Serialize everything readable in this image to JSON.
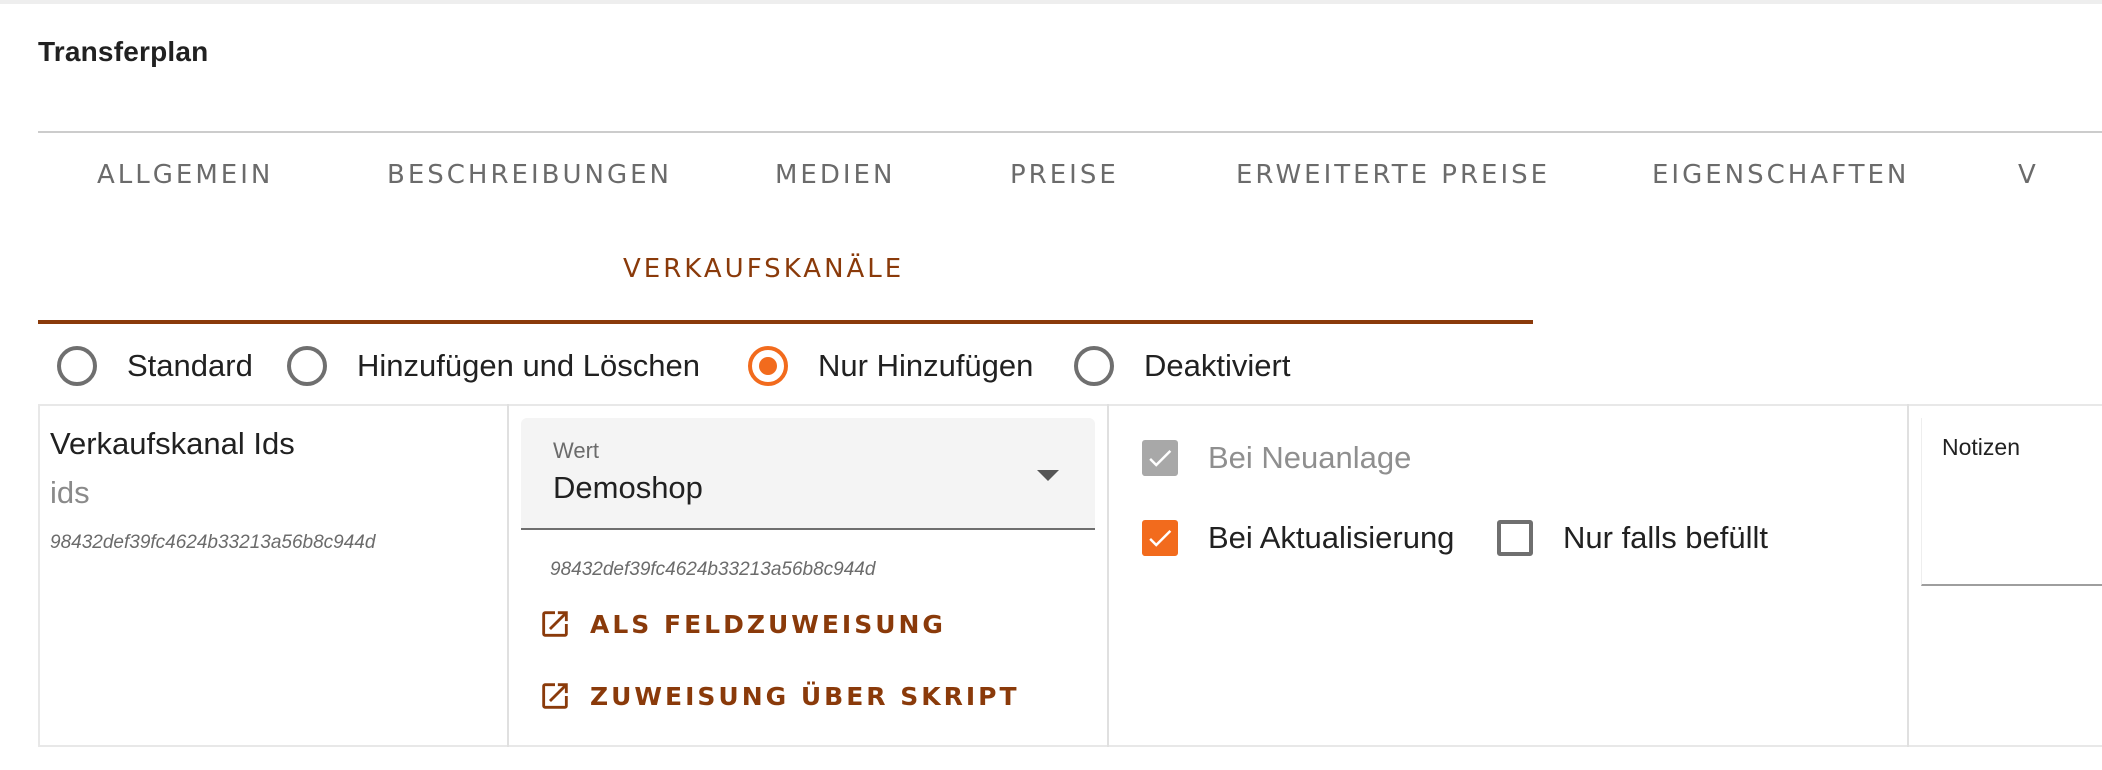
{
  "page": {
    "title": "Transferplan"
  },
  "tabs": [
    {
      "label": "ALLGEMEIN"
    },
    {
      "label": "BESCHREIBUNGEN"
    },
    {
      "label": "MEDIEN"
    },
    {
      "label": "PREISE"
    },
    {
      "label": "ERWEITERTE PREISE"
    },
    {
      "label": "EIGENSCHAFTEN"
    },
    {
      "label": "V"
    },
    {
      "label": "VERKAUFSKANÄLE",
      "active": true
    }
  ],
  "mode_options": [
    {
      "label": "Standard",
      "selected": false
    },
    {
      "label": "Hinzufügen und Löschen",
      "selected": false
    },
    {
      "label": "Nur Hinzufügen",
      "selected": true
    },
    {
      "label": "Deaktiviert",
      "selected": false
    }
  ],
  "mapping": {
    "field_name": "Verkaufskanal Ids",
    "field_key": "ids",
    "field_id": "98432def39fc4624b33213a56b8c944d",
    "value": {
      "label": "Wert",
      "selected": "Demoshop",
      "selected_id": "98432def39fc4624b33213a56b8c944d"
    },
    "actions": {
      "field_assignment": "ALS FELDZUWEISUNG",
      "script_assignment": "ZUWEISUNG ÜBER SKRIPT"
    },
    "options": {
      "on_create": {
        "label": "Bei Neuanlage",
        "checked": true,
        "disabled": true
      },
      "on_update": {
        "label": "Bei Aktualisierung",
        "checked": true
      },
      "only_if_filled": {
        "label": "Nur falls befüllt",
        "checked": false
      }
    },
    "notes": {
      "label": "Notizen",
      "value": ""
    }
  },
  "colors": {
    "accent": "#f26b1d",
    "brand_dark": "#8a3a0a",
    "text": "#212121",
    "muted": "#6b6b6b"
  }
}
